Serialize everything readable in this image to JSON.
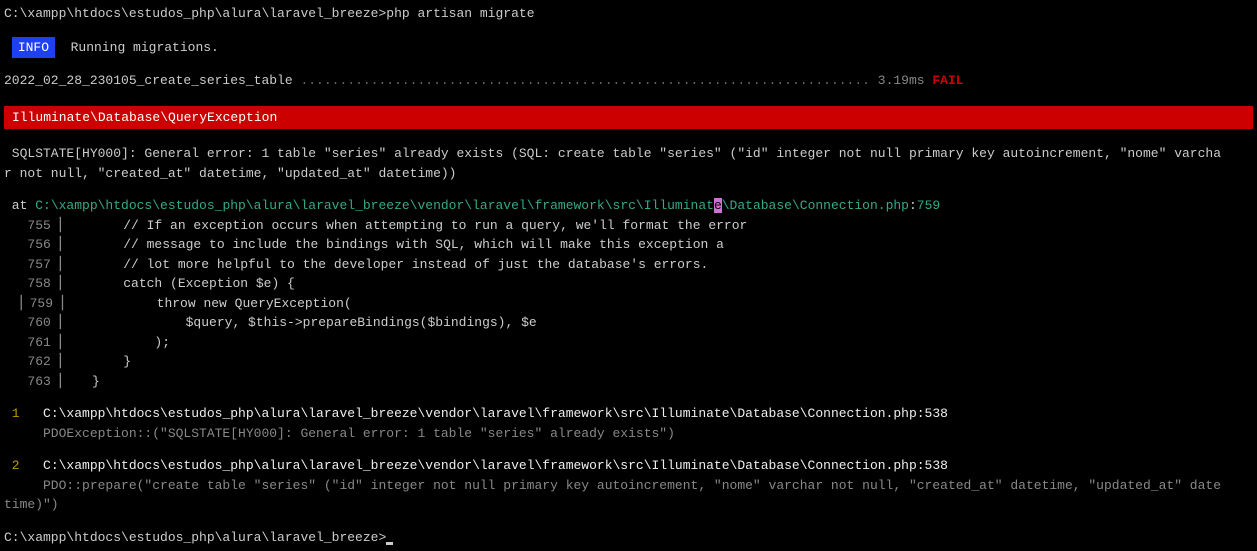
{
  "prompt1": "C:\\xampp\\htdocs\\estudos_php\\alura\\laravel_breeze>",
  "command": "php artisan migrate",
  "infoBadge": "INFO",
  "infoText": "  Running migrations.",
  "migration": {
    "name": "2022_02_28_230105_create_series_table",
    "dots": " ......................................................................... ",
    "ms": "3.19ms ",
    "status": "FAIL"
  },
  "errorHeader": " Illuminate\\Database\\QueryException ",
  "sqlstate1": " SQLSTATE[HY000]: General error: 1 table \"series\" already exists (SQL: create table \"series\" (\"id\" integer not null primary key autoincrement, \"nome\" varcha",
  "sqlstate2": "r not null, \"created_at\" datetime, \"updated_at\" datetime))",
  "atPrefix": " at ",
  "atPath1": "C:\\xampp\\htdocs\\estudos_php\\alura\\laravel_breeze\\vendor\\laravel\\framework\\src\\Illuminat",
  "atPathHi": "e",
  "atPath2": "\\Database\\Connection.php",
  "atColon": ":",
  "atLine": "759",
  "code": {
    "l755": {
      "num": "   755",
      "box": "▕",
      "text": "        // If an exception occurs when attempting to run a query, we'll format the error"
    },
    "l756": {
      "num": "   756",
      "box": "▕",
      "text": "        // message to include the bindings with SQL, which will make this exception a"
    },
    "l757": {
      "num": "   757",
      "box": "▕",
      "text": "        // lot more helpful to the developer instead of just the database's errors."
    },
    "l758": {
      "num": "   758",
      "box": "▕",
      "text": "        catch (Exception $e) {"
    },
    "l759": {
      "marker": " ▕",
      "num": " 759",
      "box": "▕",
      "text": "            throw new QueryException("
    },
    "l760": {
      "num": "   760",
      "box": "▕",
      "text": "                $query, $this->prepareBindings($bindings), $e"
    },
    "l761": {
      "num": "   761",
      "box": "▕",
      "text": "            );"
    },
    "l762": {
      "num": "   762",
      "box": "▕",
      "text": "        }"
    },
    "l763": {
      "num": "   763",
      "box": "▕",
      "text": "    }"
    }
  },
  "stack": {
    "s1": {
      "num": " 1",
      "path": "   C:\\xampp\\htdocs\\estudos_php\\alura\\laravel_breeze\\vendor\\laravel\\framework\\src\\Illuminate\\Database\\Connection.php:538",
      "detail": "     PDOException::(\"SQLSTATE[HY000]: General error: 1 table \"series\" already exists\")"
    },
    "s2": {
      "num": " 2",
      "path": "   C:\\xampp\\htdocs\\estudos_php\\alura\\laravel_breeze\\vendor\\laravel\\framework\\src\\Illuminate\\Database\\Connection.php:538",
      "detail1": "     PDO::prepare(\"create table \"series\" (\"id\" integer not null primary key autoincrement, \"nome\" varchar not null, \"created_at\" datetime, \"updated_at\" date",
      "detail2": "time)\")"
    }
  },
  "prompt2": "C:\\xampp\\htdocs\\estudos_php\\alura\\laravel_breeze>"
}
